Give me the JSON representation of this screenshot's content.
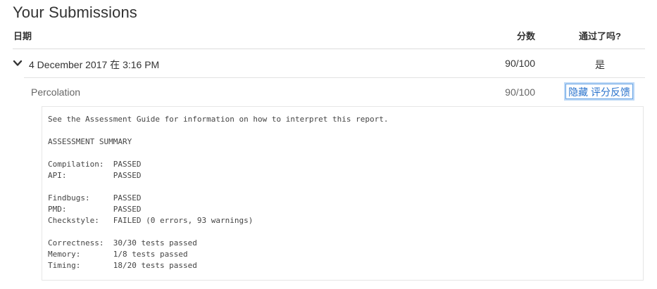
{
  "page": {
    "title": "Your Submissions"
  },
  "table": {
    "headers": {
      "date": "日期",
      "score": "分数",
      "passed": "通过了吗?"
    }
  },
  "submission": {
    "date": "4 December 2017 在 3:16 PM",
    "score": "90/100",
    "passed": "是",
    "expanded": true,
    "expand_icon": "chevron-down-icon"
  },
  "part": {
    "name": "Percolation",
    "score": "90/100",
    "feedback_button_label": "隐藏 评分反馈"
  },
  "report": {
    "lines": [
      "See the Assessment Guide for information on how to interpret this report.",
      "",
      "ASSESSMENT SUMMARY",
      "",
      "Compilation:  PASSED",
      "API:          PASSED",
      "",
      "Findbugs:     PASSED",
      "PMD:          PASSED",
      "Checkstyle:   FAILED (0 errors, 93 warnings)",
      "",
      "Correctness:  30/30 tests passed",
      "Memory:       1/8 tests passed",
      "Timing:       18/20 tests passed"
    ]
  },
  "colors": {
    "accent": "#2a73cc",
    "text": "#333333",
    "muted": "#666666",
    "border": "#dcdcdc"
  }
}
